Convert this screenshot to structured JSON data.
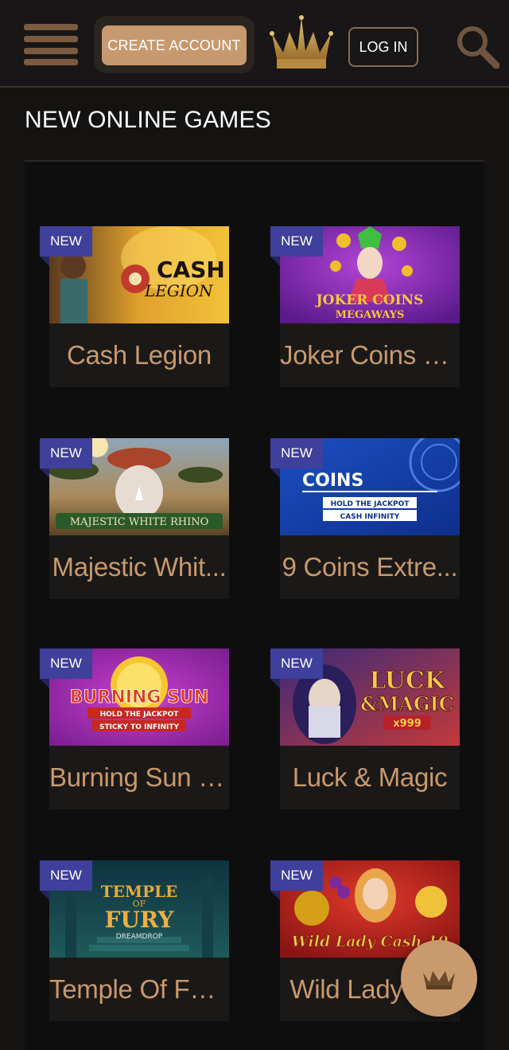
{
  "header": {
    "create_account_label": "CREATE ACCOUNT",
    "login_label": "LOG IN",
    "menu_icon": "hamburger-menu-icon",
    "logo_icon": "crown-icon",
    "search_icon": "search-icon"
  },
  "section": {
    "title": "NEW ONLINE GAMES"
  },
  "games": [
    {
      "title": "Cash Legion",
      "badge": "NEW",
      "art_text": [
        "CASH",
        "LEGION"
      ]
    },
    {
      "title": "Joker Coins M...",
      "badge": "NEW",
      "art_text": [
        "JOKER COINS",
        "MEGAWAYS"
      ]
    },
    {
      "title": "Majestic Whit...",
      "badge": "NEW",
      "art_text": [
        "MAJESTIC WHITE RHINO"
      ]
    },
    {
      "title": "9 Coins Extre...",
      "badge": "NEW",
      "art_text": [
        "COINS",
        "HOLD THE JACKPOT",
        "CASH INFINITY"
      ]
    },
    {
      "title": "Burning Sun E...",
      "badge": "NEW",
      "art_text": [
        "BURNING SUN",
        "HOLD THE JACKPOT",
        "STICKY TO INFINITY"
      ]
    },
    {
      "title": "Luck & Magic",
      "badge": "NEW",
      "art_text": [
        "LUCK",
        "&MAGIC",
        "x999"
      ]
    },
    {
      "title": "Temple Of Fur...",
      "badge": "NEW",
      "art_text": [
        "TEMPLE",
        "OF",
        "FURY",
        "DREAMDROP"
      ]
    },
    {
      "title": "Wild Lady C...",
      "badge": "NEW",
      "art_text": [
        "Wild Lady Cash 10"
      ]
    }
  ],
  "floating_button": {
    "icon": "crown-icon"
  },
  "colors": {
    "accent": "#c89a6e",
    "badge": "#3f3f9c",
    "background": "#151312",
    "panel": "#0f0e0e",
    "title_text": "#c9996b"
  }
}
